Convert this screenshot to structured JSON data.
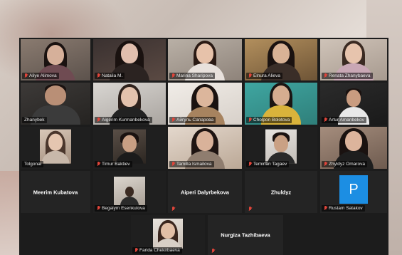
{
  "participants": {
    "row1": [
      {
        "name": "Aliye Alimova"
      },
      {
        "name": "Natalia M."
      },
      {
        "name": "Marina Sharipova"
      },
      {
        "name": "Elnura Alieva"
      },
      {
        "name": "Renata Zhanybaeva"
      }
    ],
    "row2": [
      {
        "name": "Zhanybek"
      },
      {
        "name": "Aigerim Kurmanbekova"
      },
      {
        "name": "Айгуль Сапарова"
      },
      {
        "name": "Cholpon Bolotova"
      },
      {
        "name": "Artur Amanbekov"
      }
    ],
    "row3": [
      {
        "name": "Tolgonai"
      },
      {
        "name": "Timur Baktiev"
      },
      {
        "name": "Tamilla Ismailova"
      },
      {
        "name": "Temirlan Tagaev"
      },
      {
        "name": "Zhyldyz Omarova"
      }
    ],
    "row4": [
      {
        "display_name": "Meerim Kubatova"
      },
      {
        "name": "Begaiym Esenkulova"
      },
      {
        "display_name": "Aiperi  Dalyrbekova"
      },
      {
        "display_name": "Zhuldyz"
      },
      {
        "name": "Rustam Satakov",
        "avatar_letter": "P",
        "avatar_color": "#1c8ee3"
      }
    ],
    "row5": [
      {
        "name": "Farida Chekirbaeva"
      },
      {
        "display_name": "Nurgiza  Tazhibaeva"
      }
    ]
  },
  "theme": {
    "grid_background": "#1c1c1c",
    "tile_background": "#242424",
    "active_speaker_border": "#9fd24a",
    "muted_mic_color": "#e0453a"
  }
}
